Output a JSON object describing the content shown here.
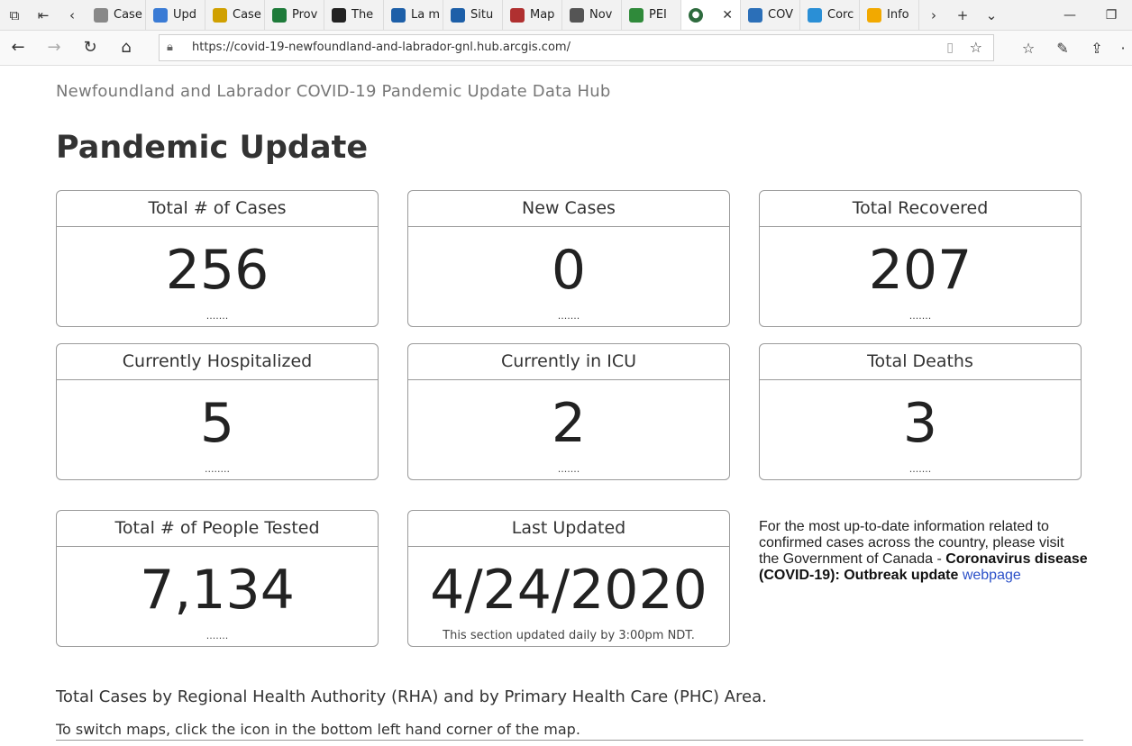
{
  "browser": {
    "tabs": [
      {
        "label": "Case",
        "color": "#888888"
      },
      {
        "label": "Upd",
        "color": "#3a7bd5"
      },
      {
        "label": "Case",
        "color": "#d0a000"
      },
      {
        "label": "Prov",
        "color": "#1e7b3a"
      },
      {
        "label": "The",
        "color": "#222222"
      },
      {
        "label": "La m",
        "color": "#1d5fa8"
      },
      {
        "label": "Situ",
        "color": "#1d5fa8"
      },
      {
        "label": "Map",
        "color": "#b03030"
      },
      {
        "label": "Nov",
        "color": "#555555"
      },
      {
        "label": "PEI",
        "color": "#2f8a3a"
      }
    ],
    "active_tab": {
      "label": "",
      "color": "#2e6b3e"
    },
    "tabs_after": [
      {
        "label": "COV",
        "color": "#2b6fb8"
      },
      {
        "label": "Corc",
        "color": "#2a8fd6"
      },
      {
        "label": "Info",
        "color": "#f2a900"
      }
    ],
    "url": "https://covid-19-newfoundland-and-labrador-gnl.hub.arcgis.com/"
  },
  "page": {
    "hub_title": "Newfoundland and Labrador COVID-19 Pandemic Update Data Hub",
    "title": "Pandemic Update",
    "cards": [
      {
        "label": "Total # of Cases",
        "value": "256",
        "footer": "......."
      },
      {
        "label": "New Cases",
        "value": "0",
        "footer": "......."
      },
      {
        "label": "Total Recovered",
        "value": "207",
        "footer": "......."
      },
      {
        "label": "Currently Hospitalized",
        "value": "5",
        "footer": "........"
      },
      {
        "label": "Currently in ICU",
        "value": "2",
        "footer": "......."
      },
      {
        "label": "Total Deaths",
        "value": "3",
        "footer": "......."
      },
      {
        "label": "Total # of People Tested",
        "value": "7,134",
        "footer": "......."
      },
      {
        "label": "Last Updated",
        "value": "4/24/2020",
        "footer": "This section updated daily by 3:00pm NDT."
      }
    ],
    "info_text": "For the most up-to-date information related to confirmed cases across the country, please visit the Government of Canada - ",
    "info_bold": "Coronavirus disease (COVID-19): Outbreak update",
    "info_link": "webpage",
    "rha_text": "Total Cases by Regional Health Authority (RHA) and by Primary Health Care (PHC) Area.",
    "switch_text": "To switch maps, click the icon in the bottom left hand corner of the map."
  }
}
